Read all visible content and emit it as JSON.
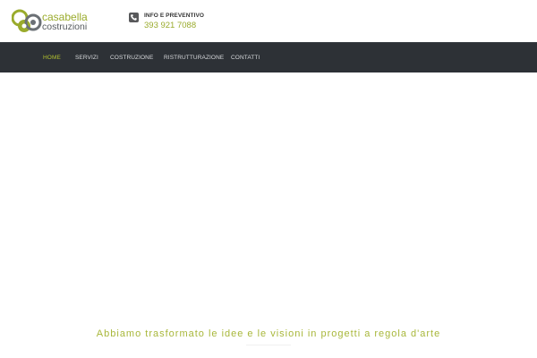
{
  "header": {
    "logo": {
      "name_line1": "casabella",
      "name_line2": "costruzioni",
      "brand_green": "#9aab2c",
      "brand_gray": "#555a5e"
    },
    "contact": {
      "icon": "phone-icon",
      "label": "INFO E PREVENTIVO",
      "phone": "393 921 7088"
    }
  },
  "nav": {
    "background": "#2d3136",
    "active_color": "#b3c12f",
    "items": [
      {
        "label": "HOME",
        "active": true
      },
      {
        "label": "SERVIZI",
        "active": false
      },
      {
        "label": "COSTRUZIONE",
        "active": false
      },
      {
        "label": "RISTRUTTURAZIONE",
        "active": false
      },
      {
        "label": "CONTATTI",
        "active": false
      }
    ]
  },
  "hero": {
    "tagline": "Abbiamo trasformato le idee e le visioni in progetti a regola d'arte"
  }
}
